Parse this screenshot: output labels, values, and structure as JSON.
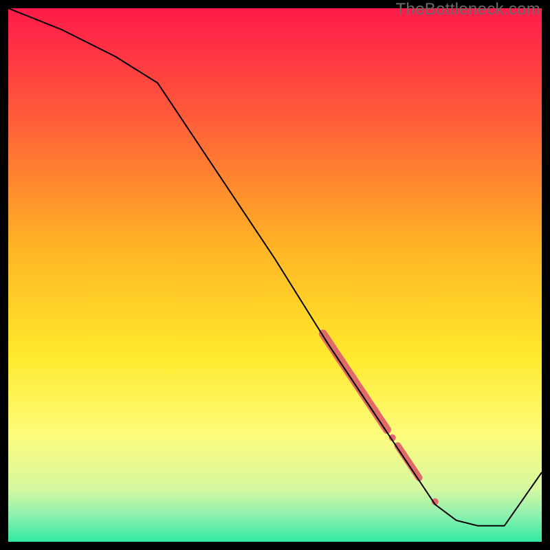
{
  "watermark": "TheBottleneck.com",
  "chart_data": {
    "type": "line",
    "title": "",
    "xlabel": "",
    "ylabel": "",
    "xlim": [
      0,
      100
    ],
    "ylim": [
      0,
      100
    ],
    "grid": false,
    "legend": false,
    "background": {
      "type": "vertical_gradient",
      "stops": [
        {
          "pos": 0.0,
          "color": "#ff1a4a"
        },
        {
          "pos": 0.2,
          "color": "#ff5a3a"
        },
        {
          "pos": 0.45,
          "color": "#ffb524"
        },
        {
          "pos": 0.65,
          "color": "#ffe92c"
        },
        {
          "pos": 0.8,
          "color": "#fdfc7c"
        },
        {
          "pos": 0.9,
          "color": "#d6f8a0"
        },
        {
          "pos": 0.95,
          "color": "#8ef0b0"
        },
        {
          "pos": 1.0,
          "color": "#2feaa0"
        }
      ]
    },
    "series": [
      {
        "name": "bottleneck-curve",
        "color": "#000000",
        "width": 2,
        "x": [
          0,
          10,
          20,
          28,
          40,
          50,
          60,
          70,
          76,
          80,
          84,
          88,
          93,
          100
        ],
        "y": [
          100,
          96,
          91,
          86,
          68,
          53,
          37,
          22,
          13,
          7,
          4,
          3,
          3,
          13
        ]
      }
    ],
    "markers": [
      {
        "name": "highlight-segment-1",
        "type": "thick-line",
        "color": "#e06a6a",
        "width": 12,
        "x": [
          59,
          71
        ],
        "y": [
          39,
          21
        ]
      },
      {
        "name": "highlight-segment-2",
        "type": "thick-line",
        "color": "#e06a6a",
        "width": 10,
        "x": [
          73,
          77
        ],
        "y": [
          18,
          12
        ]
      },
      {
        "name": "highlight-dot-1",
        "type": "dot",
        "color": "#e06a6a",
        "r": 5,
        "x": 72,
        "y": 19.5
      },
      {
        "name": "highlight-dot-2",
        "type": "dot",
        "color": "#e06a6a",
        "r": 5,
        "x": 80,
        "y": 7.5
      }
    ]
  }
}
